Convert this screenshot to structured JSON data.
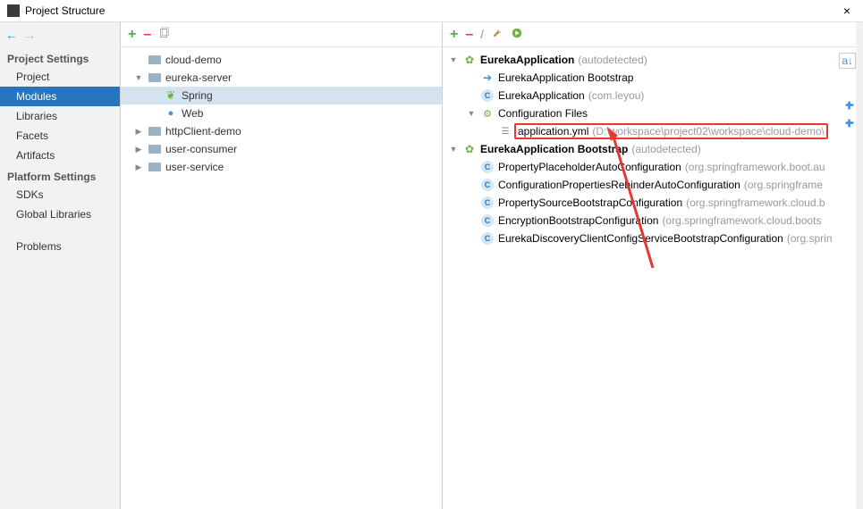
{
  "titlebar": {
    "title": "Project Structure",
    "close": "×"
  },
  "nav": {
    "sections": [
      {
        "label": "Project Settings",
        "items": [
          "Project",
          "Modules",
          "Libraries",
          "Facets",
          "Artifacts"
        ],
        "selected": "Modules"
      },
      {
        "label": "Platform Settings",
        "items": [
          "SDKs",
          "Global Libraries"
        ]
      },
      {
        "label": "",
        "items": [
          "Problems"
        ]
      }
    ]
  },
  "midToolbar": {
    "add": "+",
    "remove": "–"
  },
  "moduleTree": [
    {
      "depth": 0,
      "exp": "",
      "icon": "folder",
      "label": "cloud-demo"
    },
    {
      "depth": 0,
      "exp": "v",
      "icon": "folder",
      "label": "eureka-server"
    },
    {
      "depth": 1,
      "exp": "",
      "icon": "spring",
      "label": "Spring",
      "selected": true
    },
    {
      "depth": 1,
      "exp": "",
      "icon": "web",
      "label": "Web"
    },
    {
      "depth": 0,
      "exp": ">",
      "icon": "folder",
      "label": "httpClient-demo"
    },
    {
      "depth": 0,
      "exp": ">",
      "icon": "folder",
      "label": "user-consumer"
    },
    {
      "depth": 0,
      "exp": ">",
      "icon": "folder",
      "label": "user-service"
    }
  ],
  "rightToolbar": {
    "add": "+",
    "remove": "–",
    "edit": "/"
  },
  "rightTree": [
    {
      "depth": 0,
      "exp": "v",
      "icon": "spring2",
      "bold": "EurekaApplication",
      "dim": "(autodetected)"
    },
    {
      "depth": 1,
      "exp": "",
      "icon": "arrow",
      "norm": "EurekaApplication Bootstrap"
    },
    {
      "depth": 1,
      "exp": "",
      "icon": "c",
      "norm": "EurekaApplication",
      "dim": "(com.leyou)"
    },
    {
      "depth": 1,
      "exp": "v",
      "icon": "cfg",
      "norm": "Configuration Files"
    },
    {
      "depth": 2,
      "exp": "",
      "icon": "file",
      "norm": "application.yml",
      "dim": "(D:\\workspace\\project02\\workspace\\cloud-demo\\",
      "highlight": true
    },
    {
      "depth": 0,
      "exp": "v",
      "icon": "spring2",
      "bold": "EurekaApplication Bootstrap",
      "dim": "(autodetected)"
    },
    {
      "depth": 1,
      "exp": "",
      "icon": "c",
      "norm": "PropertyPlaceholderAutoConfiguration",
      "dim": "(org.springframework.boot.au"
    },
    {
      "depth": 1,
      "exp": "",
      "icon": "c",
      "norm": "ConfigurationPropertiesRebinderAutoConfiguration",
      "dim": "(org.springframe"
    },
    {
      "depth": 1,
      "exp": "",
      "icon": "c",
      "norm": "PropertySourceBootstrapConfiguration",
      "dim": "(org.springframework.cloud.b"
    },
    {
      "depth": 1,
      "exp": "",
      "icon": "c",
      "norm": "EncryptionBootstrapConfiguration",
      "dim": "(org.springframework.cloud.boots"
    },
    {
      "depth": 1,
      "exp": "",
      "icon": "c",
      "norm": "EurekaDiscoveryClientConfigServiceBootstrapConfiguration",
      "dim": "(org.sprin"
    }
  ],
  "sortIcon": "a↓"
}
